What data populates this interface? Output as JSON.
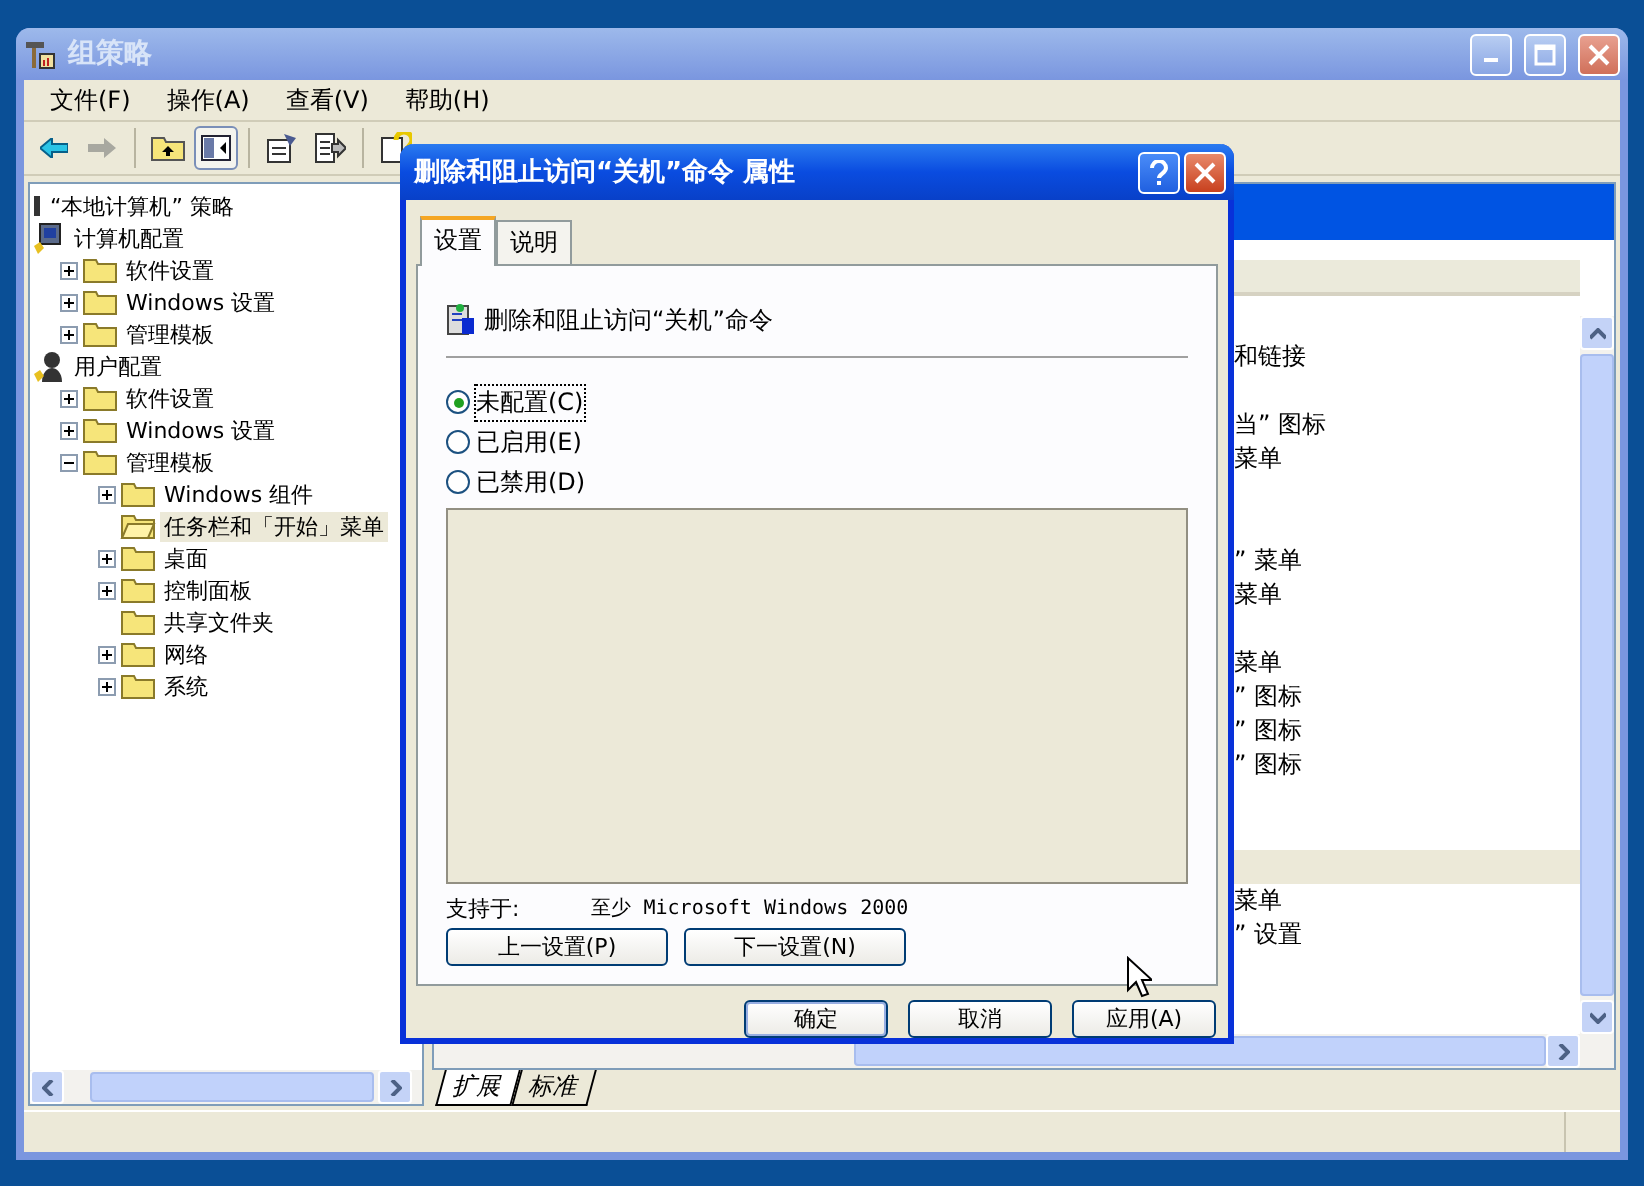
{
  "window": {
    "title": "组策略"
  },
  "menu": [
    "文件(F)",
    "操作(A)",
    "查看(V)",
    "帮助(H)"
  ],
  "toolbar": [
    {
      "kind": "back",
      "pressed": false
    },
    {
      "kind": "forward",
      "pressed": false
    },
    {
      "kind": "sep"
    },
    {
      "kind": "up",
      "pressed": false
    },
    {
      "kind": "tree",
      "pressed": true
    },
    {
      "kind": "sep"
    },
    {
      "kind": "properties",
      "pressed": false
    },
    {
      "kind": "export",
      "pressed": false
    },
    {
      "kind": "sep"
    },
    {
      "kind": "help",
      "pressed": false
    }
  ],
  "tree": [
    {
      "label": "“本地计算机” 策略",
      "kind": "policy",
      "selected": false,
      "children": [
        {
          "label": "计算机配置",
          "kind": "computer",
          "selected": false,
          "children": [
            {
              "label": "软件设置",
              "kind": "folder",
              "selected": false,
              "expanded": false
            },
            {
              "label": "Windows 设置",
              "kind": "folder",
              "selected": false,
              "expanded": false
            },
            {
              "label": "管理模板",
              "kind": "folder",
              "selected": false,
              "expanded": false
            }
          ]
        },
        {
          "label": "用户配置",
          "kind": "user",
          "selected": false,
          "children": [
            {
              "label": "软件设置",
              "kind": "folder",
              "selected": false,
              "expanded": false
            },
            {
              "label": "Windows 设置",
              "kind": "folder",
              "selected": false,
              "expanded": false
            },
            {
              "label": "管理模板",
              "kind": "folder",
              "selected": false,
              "expanded": true,
              "children": [
                {
                  "label": "Windows 组件",
                  "kind": "folder",
                  "selected": false,
                  "expanded": false
                },
                {
                  "label": "任务栏和「开始」菜单",
                  "kind": "folder-open",
                  "selected": true
                },
                {
                  "label": "桌面",
                  "kind": "folder",
                  "selected": false,
                  "expanded": false
                },
                {
                  "label": "控制面板",
                  "kind": "folder",
                  "selected": false,
                  "expanded": false
                },
                {
                  "label": "共享文件夹",
                  "kind": "folder",
                  "selected": false
                },
                {
                  "label": "网络",
                  "kind": "folder",
                  "selected": false,
                  "expanded": false
                },
                {
                  "label": "系统",
                  "kind": "folder",
                  "selected": false,
                  "expanded": false
                }
              ]
            }
          ]
        }
      ]
    }
  ],
  "list_rows": [
    {
      "selected": false
    },
    {
      "text": "和链接",
      "selected": false
    },
    {
      "selected": false
    },
    {
      "text": "当” 图标",
      "selected": false
    },
    {
      "text": "菜单",
      "selected": false
    },
    {
      "selected": false
    },
    {
      "selected": false
    },
    {
      "text": "” 菜单",
      "selected": false
    },
    {
      "text": "菜单",
      "selected": false
    },
    {
      "selected": false
    },
    {
      "text": "菜单",
      "selected": false
    },
    {
      "text": "” 图标",
      "selected": false
    },
    {
      "text": "” 图标",
      "selected": false
    },
    {
      "text": "” 图标",
      "selected": false
    },
    {
      "selected": false
    },
    {
      "selected": false
    },
    {
      "selected": true
    },
    {
      "text": "菜单",
      "selected": false
    },
    {
      "text": "” 设置",
      "selected": false
    }
  ],
  "view_tabs": [
    {
      "label": "扩展",
      "selected": true
    },
    {
      "label": "标准",
      "selected": false
    }
  ],
  "dialog": {
    "title": "删除和阻止访问“关机”命令 属性",
    "tabs": [
      {
        "label": "设置",
        "selected": true
      },
      {
        "label": "说明",
        "selected": false
      }
    ],
    "setting_name": "删除和阻止访问“关机”命令",
    "options": [
      {
        "label": "未配置(C)",
        "selected": true
      },
      {
        "label": "已启用(E)",
        "selected": false
      },
      {
        "label": "已禁用(D)",
        "selected": false
      }
    ],
    "supported_label": "支持于:",
    "supported_value": "至少 Microsoft Windows 2000",
    "nav_buttons": [
      "上一设置(P)",
      "下一设置(N)"
    ],
    "buttons": [
      {
        "label": "确定",
        "default": true
      },
      {
        "label": "取消",
        "default": false
      },
      {
        "label": "应用(A)",
        "default": false
      }
    ]
  }
}
